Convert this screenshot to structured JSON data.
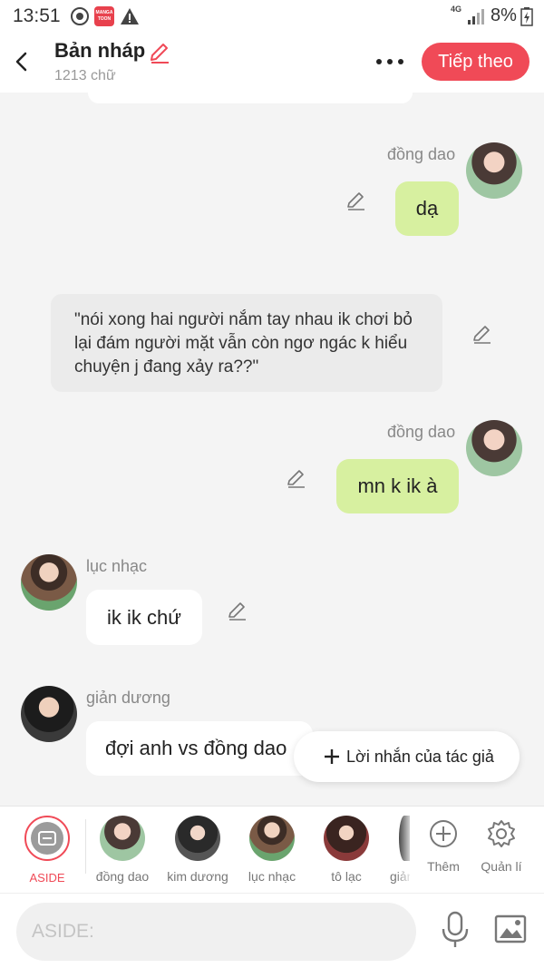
{
  "status_bar": {
    "time": "13:51",
    "app_badge": "MANGA TOON",
    "network": "4G",
    "battery": "8%"
  },
  "header": {
    "title": "Bản nháp",
    "word_count": "1213 chữ",
    "next_label": "Tiếp theo"
  },
  "colors": {
    "accent": "#f04a57",
    "my_bubble": "#d7f0a0",
    "other_bubble": "#ffffff",
    "narration_bg": "#ebebeb",
    "background": "#f4f4f4"
  },
  "messages": [
    {
      "type": "right",
      "name": "đồng dao",
      "text": "dạ",
      "avatar": "girl-avatar"
    },
    {
      "type": "narration",
      "text": "\"nói xong hai người nắm tay nhau ik chơi bỏ lại đám người mặt vẫn còn ngơ ngác k hiểu chuyện j đang xảy ra??\""
    },
    {
      "type": "right",
      "name": "đồng dao",
      "text": "mn k ik à",
      "avatar": "girl-avatar"
    },
    {
      "type": "left",
      "name": "lục nhạc",
      "text": "ik ik chứ",
      "avatar": "boy-avatar"
    },
    {
      "type": "left",
      "name": "giản dương",
      "text": "đợi anh vs đồng dao",
      "avatar": "boy2-avatar"
    }
  ],
  "author_note": {
    "label": "Lời nhắn của tác giả"
  },
  "characters": [
    {
      "label": "ASIDE",
      "icon": "aside-icon"
    },
    {
      "label": "đồng dao",
      "icon": "girl-avatar"
    },
    {
      "label": "kim dương",
      "icon": "girl2-avatar"
    },
    {
      "label": "lục nhạc",
      "icon": "boy-avatar"
    },
    {
      "label": "tô lạc",
      "icon": "girl3-avatar"
    },
    {
      "label": "giản dương",
      "icon": "boy2-avatar"
    }
  ],
  "tools": [
    {
      "label": "Thêm",
      "icon": "plus-circle-icon"
    },
    {
      "label": "Quản lí",
      "icon": "gear-icon"
    }
  ],
  "input": {
    "placeholder": "ASIDE:"
  }
}
